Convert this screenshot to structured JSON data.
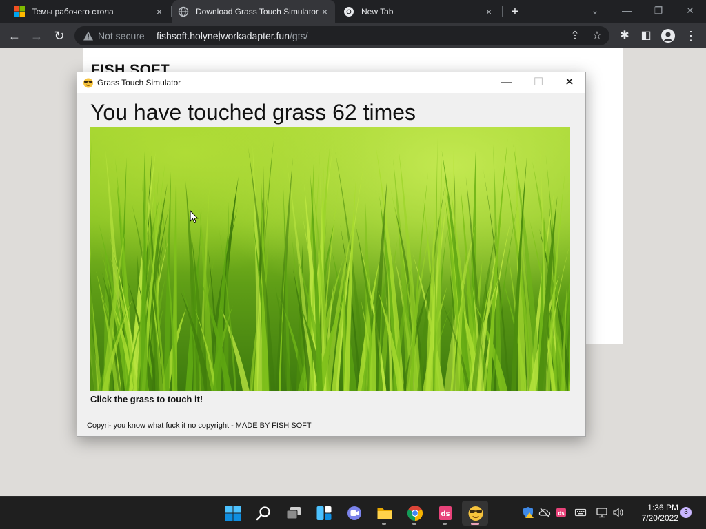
{
  "browser": {
    "tabs": [
      {
        "title": "Темы рабочего стола",
        "close": "×"
      },
      {
        "title": "Download Grass Touch Simulator",
        "close": "×",
        "active": true
      },
      {
        "title": "New Tab",
        "close": "×"
      }
    ],
    "new_tab": "+",
    "window_controls": {
      "dropdown": "⌄",
      "minimize": "—",
      "restore": "❐",
      "close": "✕"
    },
    "nav": {
      "back": "←",
      "forward": "→",
      "reload": "↻"
    },
    "security_label": "Not secure",
    "url_host": "fishsoft.holynetworkadapter.fun",
    "url_path": "/gts/",
    "omnibox_icons": {
      "share": "⇪",
      "bookmark": "☆"
    },
    "toolbar_icons": {
      "extensions": "✱",
      "sidebar": "◧",
      "menu": "⋮"
    }
  },
  "webpage": {
    "brand": "FISH SOFT"
  },
  "app": {
    "title": "Grass Touch Simulator",
    "controls": {
      "minimize": "—",
      "maximize": "☐",
      "close": "✕"
    },
    "counter_text": "You have touched grass 62 times",
    "touch_count": 62,
    "hint": "Click the grass to touch it!",
    "copyright": "Copyri- you know what fuck it no copyright - MADE BY FISH SOFT"
  },
  "taskbar": {
    "apps": [
      "start-icon",
      "search-icon",
      "task-view-icon",
      "widgets-icon",
      "chat-icon",
      "file-explorer-icon",
      "chrome-icon",
      "ds-app-icon",
      "grass-simulator-icon"
    ],
    "tray_icons": [
      "defender-warning-icon",
      "cloud-icon",
      "ds-tray-icon",
      "keyboard-icon",
      "network-icon",
      "volume-icon"
    ],
    "time": "1:36 PM",
    "date": "7/20/2022",
    "notifications": "3"
  },
  "colors": {
    "tabbar_bg": "#202124",
    "toolbar_bg": "#35363a",
    "window_bg": "#f0f0f0",
    "desktop_bg": "#dedcd9",
    "grass_light": "#b4e03a",
    "grass_dark": "#2f6a10"
  }
}
